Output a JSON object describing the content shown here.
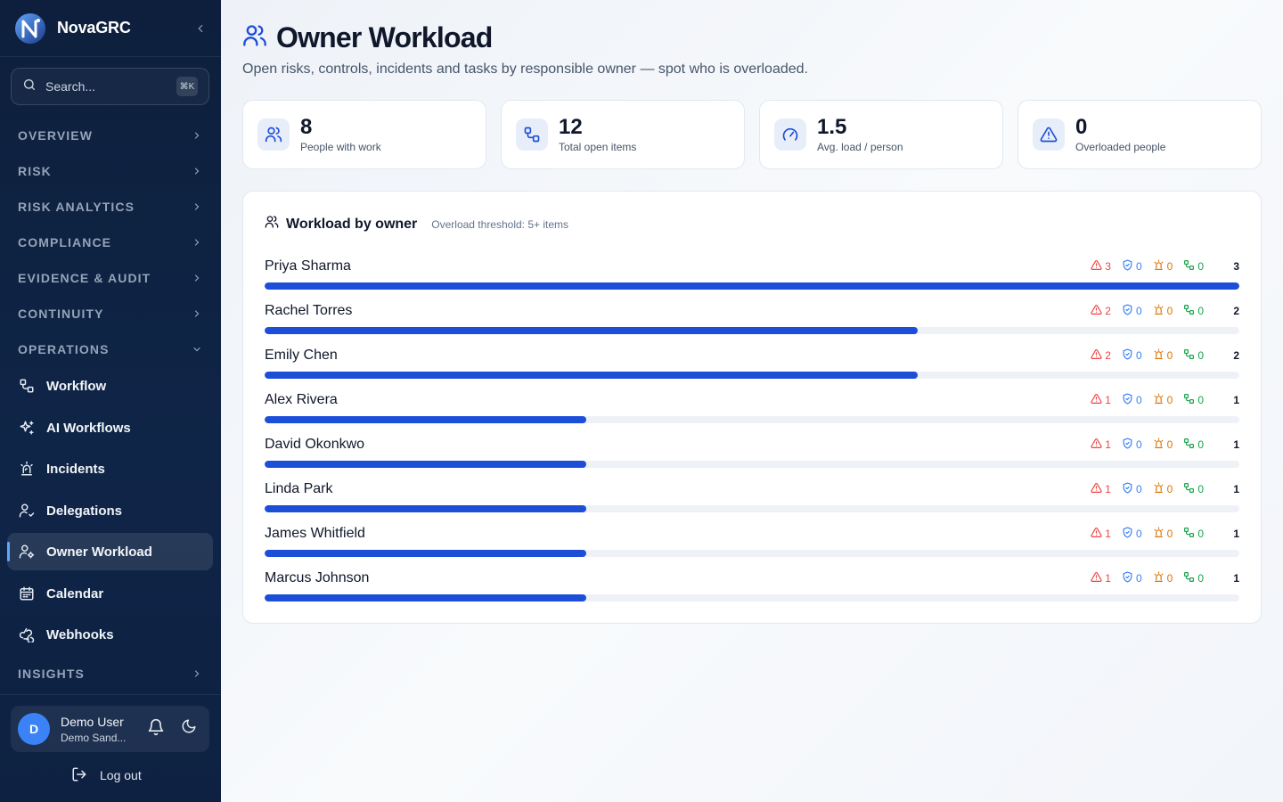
{
  "app": {
    "name": "NovaGRC"
  },
  "search": {
    "placeholder": "Search...",
    "shortcut": "⌘K"
  },
  "nav": {
    "sections": {
      "overview": "OVERVIEW",
      "risk": "RISK",
      "risk_analytics": "RISK ANALYTICS",
      "compliance": "COMPLIANCE",
      "evidence_audit": "EVIDENCE & AUDIT",
      "continuity": "CONTINUITY",
      "operations": "OPERATIONS",
      "insights": "INSIGHTS"
    },
    "items": {
      "workflow": "Workflow",
      "ai_workflows": "AI Workflows",
      "incidents": "Incidents",
      "delegations": "Delegations",
      "owner_workload": "Owner Workload",
      "calendar": "Calendar",
      "webhooks": "Webhooks"
    },
    "active": "Owner Workload"
  },
  "user": {
    "initial": "D",
    "name": "Demo User",
    "org": "Demo Sand...",
    "logout": "Log out"
  },
  "page": {
    "title": "Owner Workload",
    "subtitle": "Open risks, controls, incidents and tasks by responsible owner — spot who is overloaded."
  },
  "stats": [
    {
      "value": "8",
      "label": "People with work",
      "icon": "users-icon"
    },
    {
      "value": "12",
      "label": "Total open items",
      "icon": "workflow-icon"
    },
    {
      "value": "1.5",
      "label": "Avg. load / person",
      "icon": "gauge-icon"
    },
    {
      "value": "0",
      "label": "Overloaded people",
      "icon": "warning-icon"
    }
  ],
  "workload": {
    "title": "Workload by owner",
    "threshold": "Overload threshold: 5+ items",
    "max_total": 3,
    "owners": [
      {
        "name": "Priya Sharma",
        "risks": "3",
        "controls": "0",
        "incidents": "0",
        "tasks": "0",
        "total": "3",
        "load": 1.0
      },
      {
        "name": "Rachel Torres",
        "risks": "2",
        "controls": "0",
        "incidents": "0",
        "tasks": "0",
        "total": "2",
        "load": 0.67
      },
      {
        "name": "Emily Chen",
        "risks": "2",
        "controls": "0",
        "incidents": "0",
        "tasks": "0",
        "total": "2",
        "load": 0.67
      },
      {
        "name": "Alex Rivera",
        "risks": "1",
        "controls": "0",
        "incidents": "0",
        "tasks": "0",
        "total": "1",
        "load": 0.33
      },
      {
        "name": "David Okonkwo",
        "risks": "1",
        "controls": "0",
        "incidents": "0",
        "tasks": "0",
        "total": "1",
        "load": 0.33
      },
      {
        "name": "Linda Park",
        "risks": "1",
        "controls": "0",
        "incidents": "0",
        "tasks": "0",
        "total": "1",
        "load": 0.33
      },
      {
        "name": "James Whitfield",
        "risks": "1",
        "controls": "0",
        "incidents": "0",
        "tasks": "0",
        "total": "1",
        "load": 0.33
      },
      {
        "name": "Marcus Johnson",
        "risks": "1",
        "controls": "0",
        "incidents": "0",
        "tasks": "0",
        "total": "1",
        "load": 0.33
      }
    ]
  },
  "colors": {
    "accent": "#1d4ed8",
    "risk": "#ef4444",
    "control": "#3b82f6",
    "incident": "#d97706",
    "task": "#16a34a"
  }
}
